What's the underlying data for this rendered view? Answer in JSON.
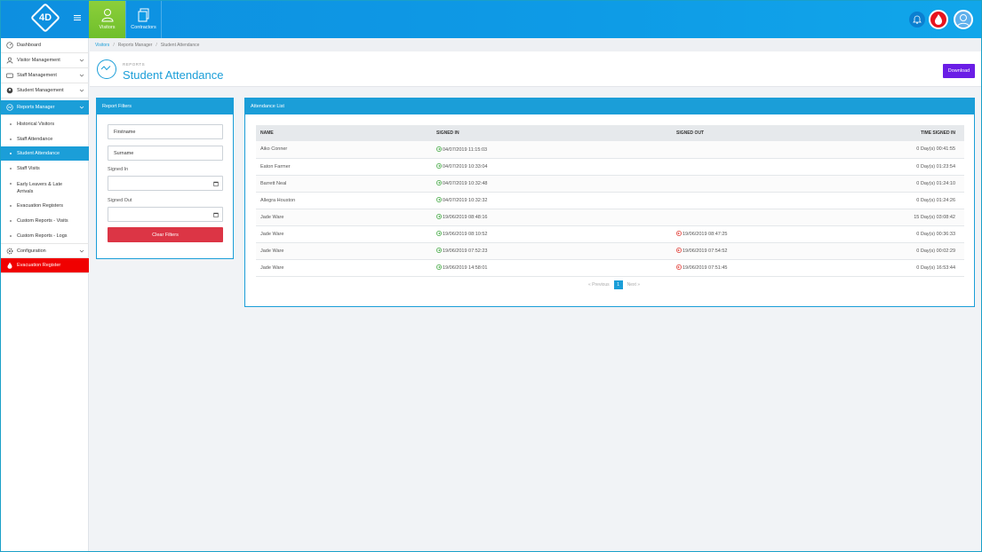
{
  "app": {
    "logo_text": "4D",
    "tabs": [
      {
        "label": "Visitors",
        "icon": "user-icon"
      },
      {
        "label": "Contractors",
        "icon": "documents-icon"
      }
    ]
  },
  "topbar": {
    "icons": [
      "menu-icon",
      "bell-icon",
      "flame-alert-icon",
      "user-avatar-icon"
    ]
  },
  "sidebar": {
    "items": [
      {
        "label": "Dashboard",
        "icon": "gauge-icon"
      },
      {
        "label": "Visitor Management",
        "icon": "user-icon"
      },
      {
        "label": "Staff Management",
        "icon": "staff-icon"
      },
      {
        "label": "Student Management",
        "icon": "student-icon"
      },
      {
        "label": "Reports Manager",
        "icon": "reports-icon"
      },
      {
        "label": "Configuration",
        "icon": "gear-icon"
      },
      {
        "label": "Evacuation Register",
        "icon": "flame-icon"
      }
    ],
    "sub_items": [
      "Historical Visitors",
      "Staff Attendance",
      "Student Attendance",
      "Staff Visits",
      "Early Leavers & Late Arrivals",
      "Evacuation Registers",
      "Custom Reports - Visits",
      "Custom Reports - Logs"
    ]
  },
  "breadcrumb": [
    "Visitors",
    "Reports Manager",
    "Student Attendance"
  ],
  "header": {
    "eyebrow": "REPORTS",
    "title": "Student Attendance",
    "download_label": "Download"
  },
  "filters": {
    "title": "Report Filters",
    "firstname_placeholder": "Firstname",
    "surname_placeholder": "Surname",
    "signed_in_label": "Signed In",
    "signed_out_label": "Signed Out",
    "clear_label": "Clear Filters"
  },
  "attendance": {
    "title": "Attendance List",
    "columns": [
      "NAME",
      "SIGNED IN",
      "SIGNED OUT",
      "TIME SIGNED IN"
    ],
    "rows": [
      {
        "name": "Aiko Conner",
        "signed_in": "04/07/2019 11:15:03",
        "signed_out": "",
        "time": "0 Day(s) 00:41:55"
      },
      {
        "name": "Eaton Farmer",
        "signed_in": "04/07/2019 10:33:04",
        "signed_out": "",
        "time": "0 Day(s) 01:23:54"
      },
      {
        "name": "Barrett Neal",
        "signed_in": "04/07/2019 10:32:48",
        "signed_out": "",
        "time": "0 Day(s) 01:24:10"
      },
      {
        "name": "Allegra Houston",
        "signed_in": "04/07/2019 10:32:32",
        "signed_out": "",
        "time": "0 Day(s) 01:24:26"
      },
      {
        "name": "Jade Ware",
        "signed_in": "19/06/2019 08:48:16",
        "signed_out": "",
        "time": "15 Day(s) 03:08:42"
      },
      {
        "name": "Jade Ware",
        "signed_in": "19/06/2019 08:10:52",
        "signed_out": "19/06/2019 08:47:25",
        "time": "0 Day(s) 00:36:33"
      },
      {
        "name": "Jade Ware",
        "signed_in": "19/06/2019 07:52:23",
        "signed_out": "19/06/2019 07:54:52",
        "time": "0 Day(s) 00:02:29"
      },
      {
        "name": "Jade Ware",
        "signed_in": "19/06/2019 14:58:01",
        "signed_out": "19/06/2019 07:51:45",
        "time": "0 Day(s) 16:53:44"
      }
    ],
    "pager": {
      "previous": "« Previous",
      "current": "1",
      "next": "Next »"
    }
  },
  "colors": {
    "accent": "#1b9ed8",
    "visitors_tab": "#7cc532",
    "download": "#6a1de6",
    "clear": "#dc3545",
    "evacuation": "#f00000",
    "signed_in": "#3aa53a",
    "signed_out": "#e0342c"
  }
}
